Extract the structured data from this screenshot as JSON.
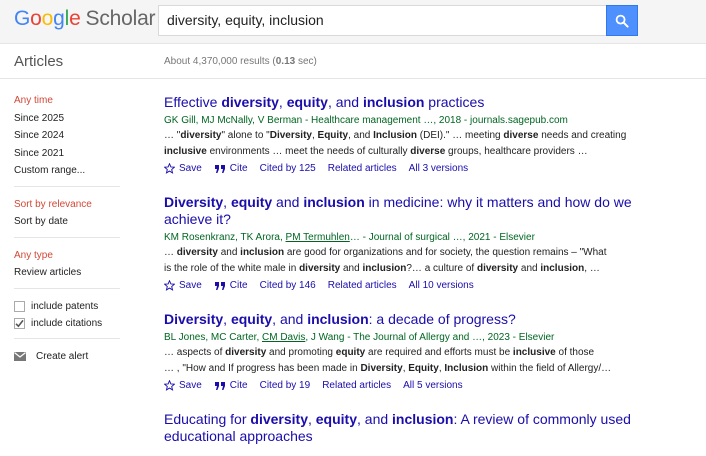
{
  "header": {
    "logo_letters": [
      "G",
      "o",
      "o",
      "g",
      "l",
      "e"
    ],
    "logo_product": "Scholar",
    "search_value": "diversity, equity, inclusion"
  },
  "subheader": {
    "tab": "Articles",
    "count_prefix": "About 4,370,000 results (",
    "count_time": "0.13",
    "count_suffix": " sec)"
  },
  "sidebar": {
    "time": [
      "Any time",
      "Since 2025",
      "Since 2024",
      "Since 2021",
      "Custom range..."
    ],
    "sort": [
      "Sort by relevance",
      "Sort by date"
    ],
    "type": [
      "Any type",
      "Review articles"
    ],
    "checks": [
      "include patents",
      "include citations"
    ],
    "alert": "Create alert"
  },
  "actions": {
    "save": "Save",
    "cite": "Cite",
    "related": "Related articles"
  },
  "results": [
    {
      "title": [
        [
          "",
          "Effective "
        ],
        [
          "b",
          "diversity"
        ],
        [
          "",
          ", "
        ],
        [
          "b",
          "equity"
        ],
        [
          "",
          ", and "
        ],
        [
          "b",
          "inclusion"
        ],
        [
          "",
          " practices"
        ]
      ],
      "meta": [
        [
          "",
          "GK Gill, MJ McNally, V Berman - Healthcare management …, 2018 - journals.sagepub.com"
        ]
      ],
      "snippet1": [
        [
          "",
          "… \""
        ],
        [
          "b",
          "diversity"
        ],
        [
          "",
          "\" alone to \""
        ],
        [
          "b",
          "Diversity"
        ],
        [
          "",
          ", "
        ],
        [
          "b",
          "Equity"
        ],
        [
          "",
          ", and "
        ],
        [
          "b",
          "Inclusion"
        ],
        [
          "",
          " (DEI).\" … meeting "
        ],
        [
          "b",
          "diverse"
        ],
        [
          "",
          " needs and creating"
        ]
      ],
      "snippet2": [
        [
          "b",
          "inclusive"
        ],
        [
          "",
          " environments … meet the needs of culturally "
        ],
        [
          "b",
          "diverse"
        ],
        [
          "",
          " groups, healthcare providers …"
        ]
      ],
      "cited_by": "Cited by 125",
      "versions": "All 3 versions"
    },
    {
      "title": [
        [
          "b",
          "Diversity"
        ],
        [
          "",
          ", "
        ],
        [
          "b",
          "equity"
        ],
        [
          "",
          " and "
        ],
        [
          "b",
          "inclusion"
        ],
        [
          "",
          " in medicine: why it matters and how do we achieve it?"
        ]
      ],
      "meta": [
        [
          "",
          "KM Rosenkranz, TK Arora, "
        ],
        [
          "u",
          "PM Termuhlen"
        ],
        [
          "",
          "… - Journal of surgical …, 2021 - Elsevier"
        ]
      ],
      "snippet1": [
        [
          "",
          "… "
        ],
        [
          "b",
          "diversity"
        ],
        [
          "",
          " and "
        ],
        [
          "b",
          "inclusion"
        ],
        [
          "",
          " are good for organizations and for society, the question remains – \"What"
        ]
      ],
      "snippet2": [
        [
          "",
          "is the role of the white male in "
        ],
        [
          "b",
          "diversity"
        ],
        [
          "",
          " and "
        ],
        [
          "b",
          "inclusion"
        ],
        [
          "",
          "?… a culture of "
        ],
        [
          "b",
          "diversity"
        ],
        [
          "",
          " and "
        ],
        [
          "b",
          "inclusion"
        ],
        [
          "",
          ", …"
        ]
      ],
      "cited_by": "Cited by 146",
      "versions": "All 10 versions"
    },
    {
      "title": [
        [
          "b",
          "Diversity"
        ],
        [
          "",
          ", "
        ],
        [
          "b",
          "equity"
        ],
        [
          "",
          ", and "
        ],
        [
          "b",
          "inclusion"
        ],
        [
          "",
          ": a decade of progress?"
        ]
      ],
      "meta": [
        [
          "",
          "BL Jones, MC Carter, "
        ],
        [
          "u",
          "CM Davis"
        ],
        [
          "",
          ", J Wang - The Journal of Allergy and …, 2023 - Elsevier"
        ]
      ],
      "snippet1": [
        [
          "",
          "… aspects of "
        ],
        [
          "b",
          "diversity"
        ],
        [
          "",
          " and promoting "
        ],
        [
          "b",
          "equity"
        ],
        [
          "",
          " are required and efforts must be "
        ],
        [
          "b",
          "inclusive"
        ],
        [
          "",
          " of those"
        ]
      ],
      "snippet2": [
        [
          "",
          "… , \"How and If progress has been made in "
        ],
        [
          "b",
          "Diversity"
        ],
        [
          "",
          ", "
        ],
        [
          "b",
          "Equity"
        ],
        [
          "",
          ", "
        ],
        [
          "b",
          "Inclusion"
        ],
        [
          "",
          " within the field of Allergy/…"
        ]
      ],
      "cited_by": "Cited by 19",
      "versions": "All 5 versions"
    },
    {
      "title": [
        [
          "",
          "Educating for "
        ],
        [
          "b",
          "diversity"
        ],
        [
          "",
          ", "
        ],
        [
          "b",
          "equity"
        ],
        [
          "",
          ", and "
        ],
        [
          "b",
          "inclusion"
        ],
        [
          "",
          ": A review of commonly used educational approaches"
        ]
      ]
    }
  ]
}
